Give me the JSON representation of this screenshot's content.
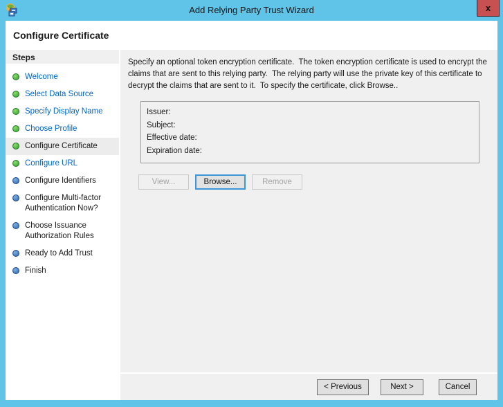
{
  "window": {
    "title": "Add Relying Party Trust Wizard",
    "close_glyph": "x"
  },
  "page": {
    "heading": "Configure Certificate"
  },
  "sidebar": {
    "title": "Steps",
    "steps": [
      {
        "label": "Welcome",
        "status": "green"
      },
      {
        "label": "Select Data Source",
        "status": "green"
      },
      {
        "label": "Specify Display Name",
        "status": "green"
      },
      {
        "label": "Choose Profile",
        "status": "green"
      },
      {
        "label": "Configure Certificate",
        "status": "green",
        "current": true
      },
      {
        "label": "Configure URL",
        "status": "green"
      },
      {
        "label": "Configure Identifiers",
        "status": "blue"
      },
      {
        "label": "Configure Multi-factor Authentication Now?",
        "status": "blue"
      },
      {
        "label": "Choose Issuance Authorization Rules",
        "status": "blue"
      },
      {
        "label": "Ready to Add Trust",
        "status": "blue"
      },
      {
        "label": "Finish",
        "status": "blue"
      }
    ]
  },
  "main": {
    "description": "Specify an optional token encryption certificate.  The token encryption certificate is used to encrypt the claims that are sent to this relying party.  The relying party will use the private key of this certificate to decrypt the claims that are sent to it.  To specify the certificate, click Browse..",
    "certificate_fields": [
      "Issuer:",
      "Subject:",
      "Effective date:",
      "Expiration date:"
    ],
    "buttons": {
      "view": "View...",
      "browse": "Browse...",
      "remove": "Remove"
    }
  },
  "footer": {
    "previous": "< Previous",
    "next": "Next >",
    "cancel": "Cancel"
  },
  "colors": {
    "titlebar": "#5fc4e7",
    "close_button": "#c75050",
    "panel": "#f0f0f0",
    "link_text": "#0066cc",
    "step_done_dot": "#3ea03e",
    "step_pending_dot": "#2d62a8",
    "focus_border": "#3c95d6"
  }
}
